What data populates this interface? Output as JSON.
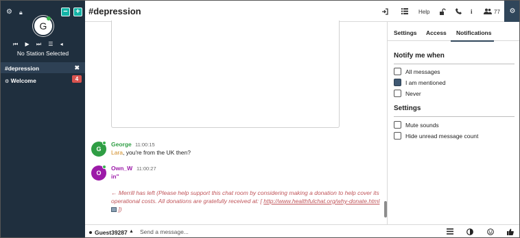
{
  "sidebar": {
    "avatar_letter": "G",
    "station_label": "No Station Selected",
    "player": {
      "prev": "⏮",
      "play": "▶",
      "next": "⏭",
      "list": "☰",
      "volume": "◂"
    },
    "add_buttons": {
      "minus": "−",
      "plus": "+"
    },
    "rooms": [
      {
        "name": "#depression",
        "close": "✖",
        "active": true
      },
      {
        "prefix": "⚙",
        "name": "Welcome",
        "unread": "4"
      }
    ]
  },
  "header": {
    "title": "#depression",
    "help_label": "Help",
    "user_count": "77"
  },
  "chat": {
    "messages": [
      {
        "avatar": "G",
        "user": "George",
        "time": "11:00:15",
        "mention": "Lara",
        "text": ", you're from the UK then?",
        "avatar_color": "#2f9e44",
        "user_color": "#2f9e44"
      },
      {
        "avatar": "O",
        "user": "Own_W",
        "time": "11:00:27",
        "text": "in\"",
        "avatar_color": "#9c1aa8",
        "user_color": "#9c1aa8"
      }
    ],
    "system": {
      "text": "← Merrill has left (Please help support this chat room by considering making a donation to help cover its operational costs. All donations are gratefully received at: [",
      "link": "http://www.healthfulchat.org/why-donate.html",
      "end": "])"
    }
  },
  "panel": {
    "tabs": [
      "Settings",
      "Access",
      "Notifications"
    ],
    "active_tab": "Notifications",
    "notify_heading": "Notify me when",
    "notify_options": [
      {
        "label": "All messages",
        "checked": false
      },
      {
        "label": "I am mentioned",
        "checked": true
      },
      {
        "label": "Never",
        "checked": false
      }
    ],
    "settings_heading": "Settings",
    "settings_options": [
      {
        "label": "Mute sounds",
        "checked": false
      },
      {
        "label": "Hide unread message count",
        "checked": false
      }
    ]
  },
  "footer": {
    "username": "Guest39287",
    "placeholder": "Send a message..."
  },
  "colors": {
    "sidebar_bg": "#1f2f3e",
    "accent_teal": "#14b3a6",
    "unread_badge": "#d9534f",
    "system_msg": "#c0555a",
    "mention": "#d08a20"
  },
  "icons": {
    "header": [
      "sign-in-icon",
      "list-icon",
      "lock-icon",
      "phone-icon",
      "info-icon",
      "users-icon",
      "gear-icon"
    ],
    "footer": [
      "menu-icon",
      "contrast-icon",
      "smile-icon",
      "thumbs-up-icon"
    ]
  }
}
